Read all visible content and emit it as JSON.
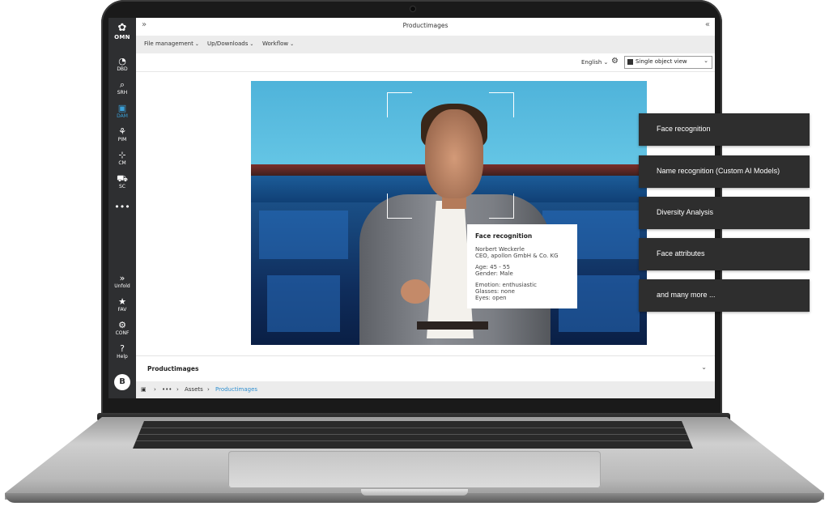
{
  "app": {
    "window_title": "Productimages",
    "collapse_left_icon": "double-chevron-right",
    "collapse_right_icon": "double-chevron-left"
  },
  "sidebar": {
    "logo_label": "OMN",
    "items": [
      {
        "label": "DBD",
        "icon": "dashboard-icon",
        "glyph": "◔"
      },
      {
        "label": "SRH",
        "icon": "search-icon",
        "glyph": "⌕"
      },
      {
        "label": "DAM",
        "icon": "images-icon",
        "glyph": "▣",
        "active": true
      },
      {
        "label": "PIM",
        "icon": "product-icon",
        "glyph": "⚘"
      },
      {
        "label": "CM",
        "icon": "network-icon",
        "glyph": "⊹"
      },
      {
        "label": "SC",
        "icon": "cart-icon",
        "glyph": "⛟"
      },
      {
        "label": "",
        "icon": "more-icon",
        "glyph": "•••"
      }
    ],
    "bottom_items": [
      {
        "label": "Unfold",
        "icon": "unfold-icon",
        "glyph": "»"
      },
      {
        "label": "FAV",
        "icon": "star-icon",
        "glyph": "★"
      },
      {
        "label": "CONF",
        "icon": "gear-icon",
        "glyph": "⚙"
      },
      {
        "label": "Help",
        "icon": "help-icon",
        "glyph": "?"
      }
    ],
    "avatar_initial": "B"
  },
  "menubar": {
    "items": [
      "File management",
      "Up/Downloads",
      "Workflow"
    ]
  },
  "toolbar": {
    "language": "English",
    "view_select": "Single object view"
  },
  "face_tooltip": {
    "title": "Face recognition",
    "name": "Norbert Weckerle",
    "role": "CEO, apollon GmbH & Co. KG",
    "age": "Age: 45 - 55",
    "gender": "Gender: Male",
    "emotion": "Emotion: enthusiastic",
    "glasses": "Glasses: none",
    "eyes": "Eyes: open"
  },
  "panel": {
    "title": "Productimages"
  },
  "breadcrumb": {
    "more": "•••",
    "assets": "Assets",
    "current": "Productimages"
  },
  "feature_cards": [
    "Face recognition",
    "Name recognition (Custom AI Models)",
    "Diversity Analysis",
    "Face attributes",
    "and many more ..."
  ],
  "colors": {
    "sidebar_bg": "#2e2f31",
    "accent": "#3aa0d8",
    "card_bg": "#2e2e2e",
    "link": "#2f8fd0"
  }
}
